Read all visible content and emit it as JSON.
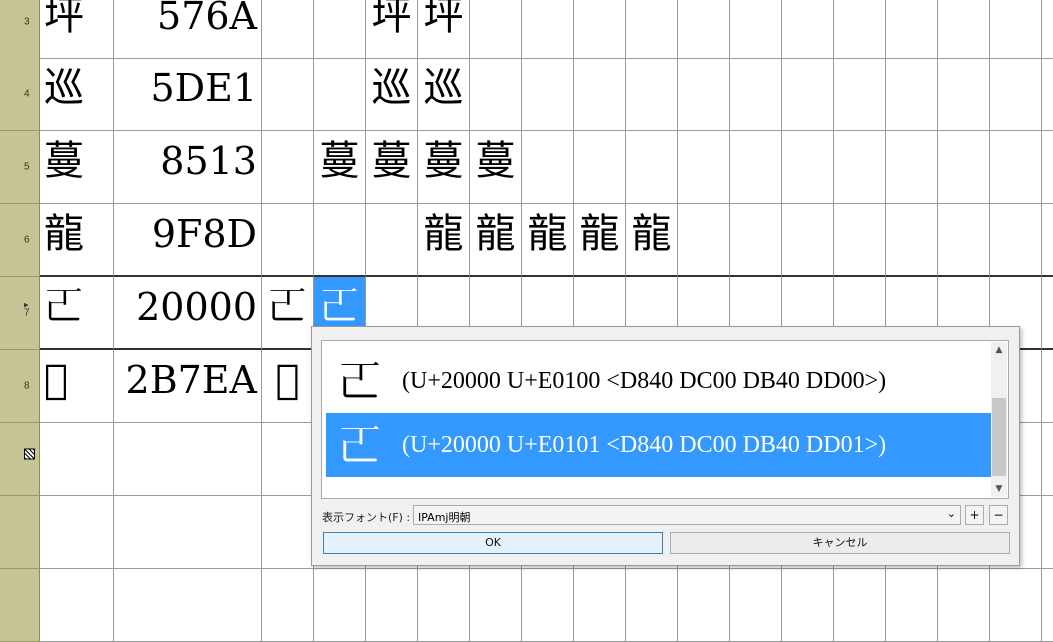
{
  "rows": [
    {
      "num": "3",
      "char": "坪",
      "code": "576A",
      "variants": [
        "",
        "",
        "坪",
        "坪",
        "",
        "",
        "",
        ""
      ]
    },
    {
      "num": "4",
      "char": "巡",
      "code": "5DE1",
      "variants": [
        "",
        "",
        "巡",
        "巡",
        "",
        "",
        "",
        ""
      ]
    },
    {
      "num": "5",
      "char": "蔓",
      "code": "8513",
      "variants": [
        "",
        "蔓",
        "蔓",
        "蔓",
        "蔓",
        "",
        "",
        ""
      ]
    },
    {
      "num": "6",
      "char": "龍",
      "code": "9F8D",
      "variants": [
        "",
        "",
        "",
        "龍",
        "龍",
        "龍",
        "龍",
        "龍"
      ]
    },
    {
      "num": "7",
      "char": "𠀀",
      "code": "20000",
      "variants": [
        "𠀀",
        "𠀀",
        "",
        "",
        "",
        "",
        "",
        ""
      ]
    },
    {
      "num": "8",
      "char": "𫟪",
      "code": "2B7EA",
      "variants": [
        "𫟪",
        "",
        "",
        "",
        "",
        "",
        "",
        ""
      ]
    }
  ],
  "popup": {
    "options": [
      {
        "glyph": "𠀀",
        "label": "(U+20000 U+E0100 <D840 DC00 DB40 DD00>)"
      },
      {
        "glyph": "𠀀",
        "label": "(U+20000 U+E0101 <D840 DC00 DB40 DD01>)"
      }
    ],
    "font_label": "表示フォント(F) :",
    "font_value": "IPAmj明朝",
    "plus": "+",
    "minus": "−",
    "ok": "OK",
    "cancel": "キャンセル",
    "scroll_up": "▲",
    "scroll_down": "▼",
    "dropdown_arrow": "⌄"
  },
  "colors": {
    "row_header": "#c6c394",
    "selection": "#3399ff"
  }
}
